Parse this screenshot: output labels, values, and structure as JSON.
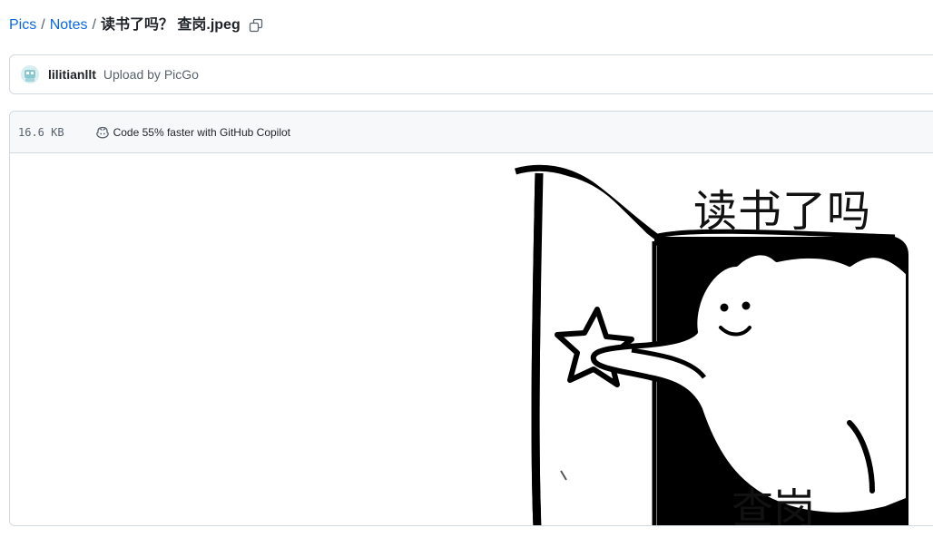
{
  "breadcrumb": {
    "root": "Pics",
    "folder": "Notes",
    "separator": "/",
    "file": "读书了吗？ 查岗.jpeg",
    "copy_icon": "copy-icon"
  },
  "commit": {
    "avatar_icon": "avatar",
    "author": "lilitianllt",
    "message": "Upload by PicGo"
  },
  "file": {
    "size": "16.6 KB",
    "copilot_icon": "copilot-icon",
    "copilot_text": "Code 55% faster with GitHub Copilot"
  },
  "image": {
    "top_text": "读书了吗",
    "bottom_text": "查岗"
  },
  "colors": {
    "link": "#0969da",
    "border": "#d1d9e0",
    "header_bg": "#f6f8fa",
    "muted_text": "#59636e"
  }
}
